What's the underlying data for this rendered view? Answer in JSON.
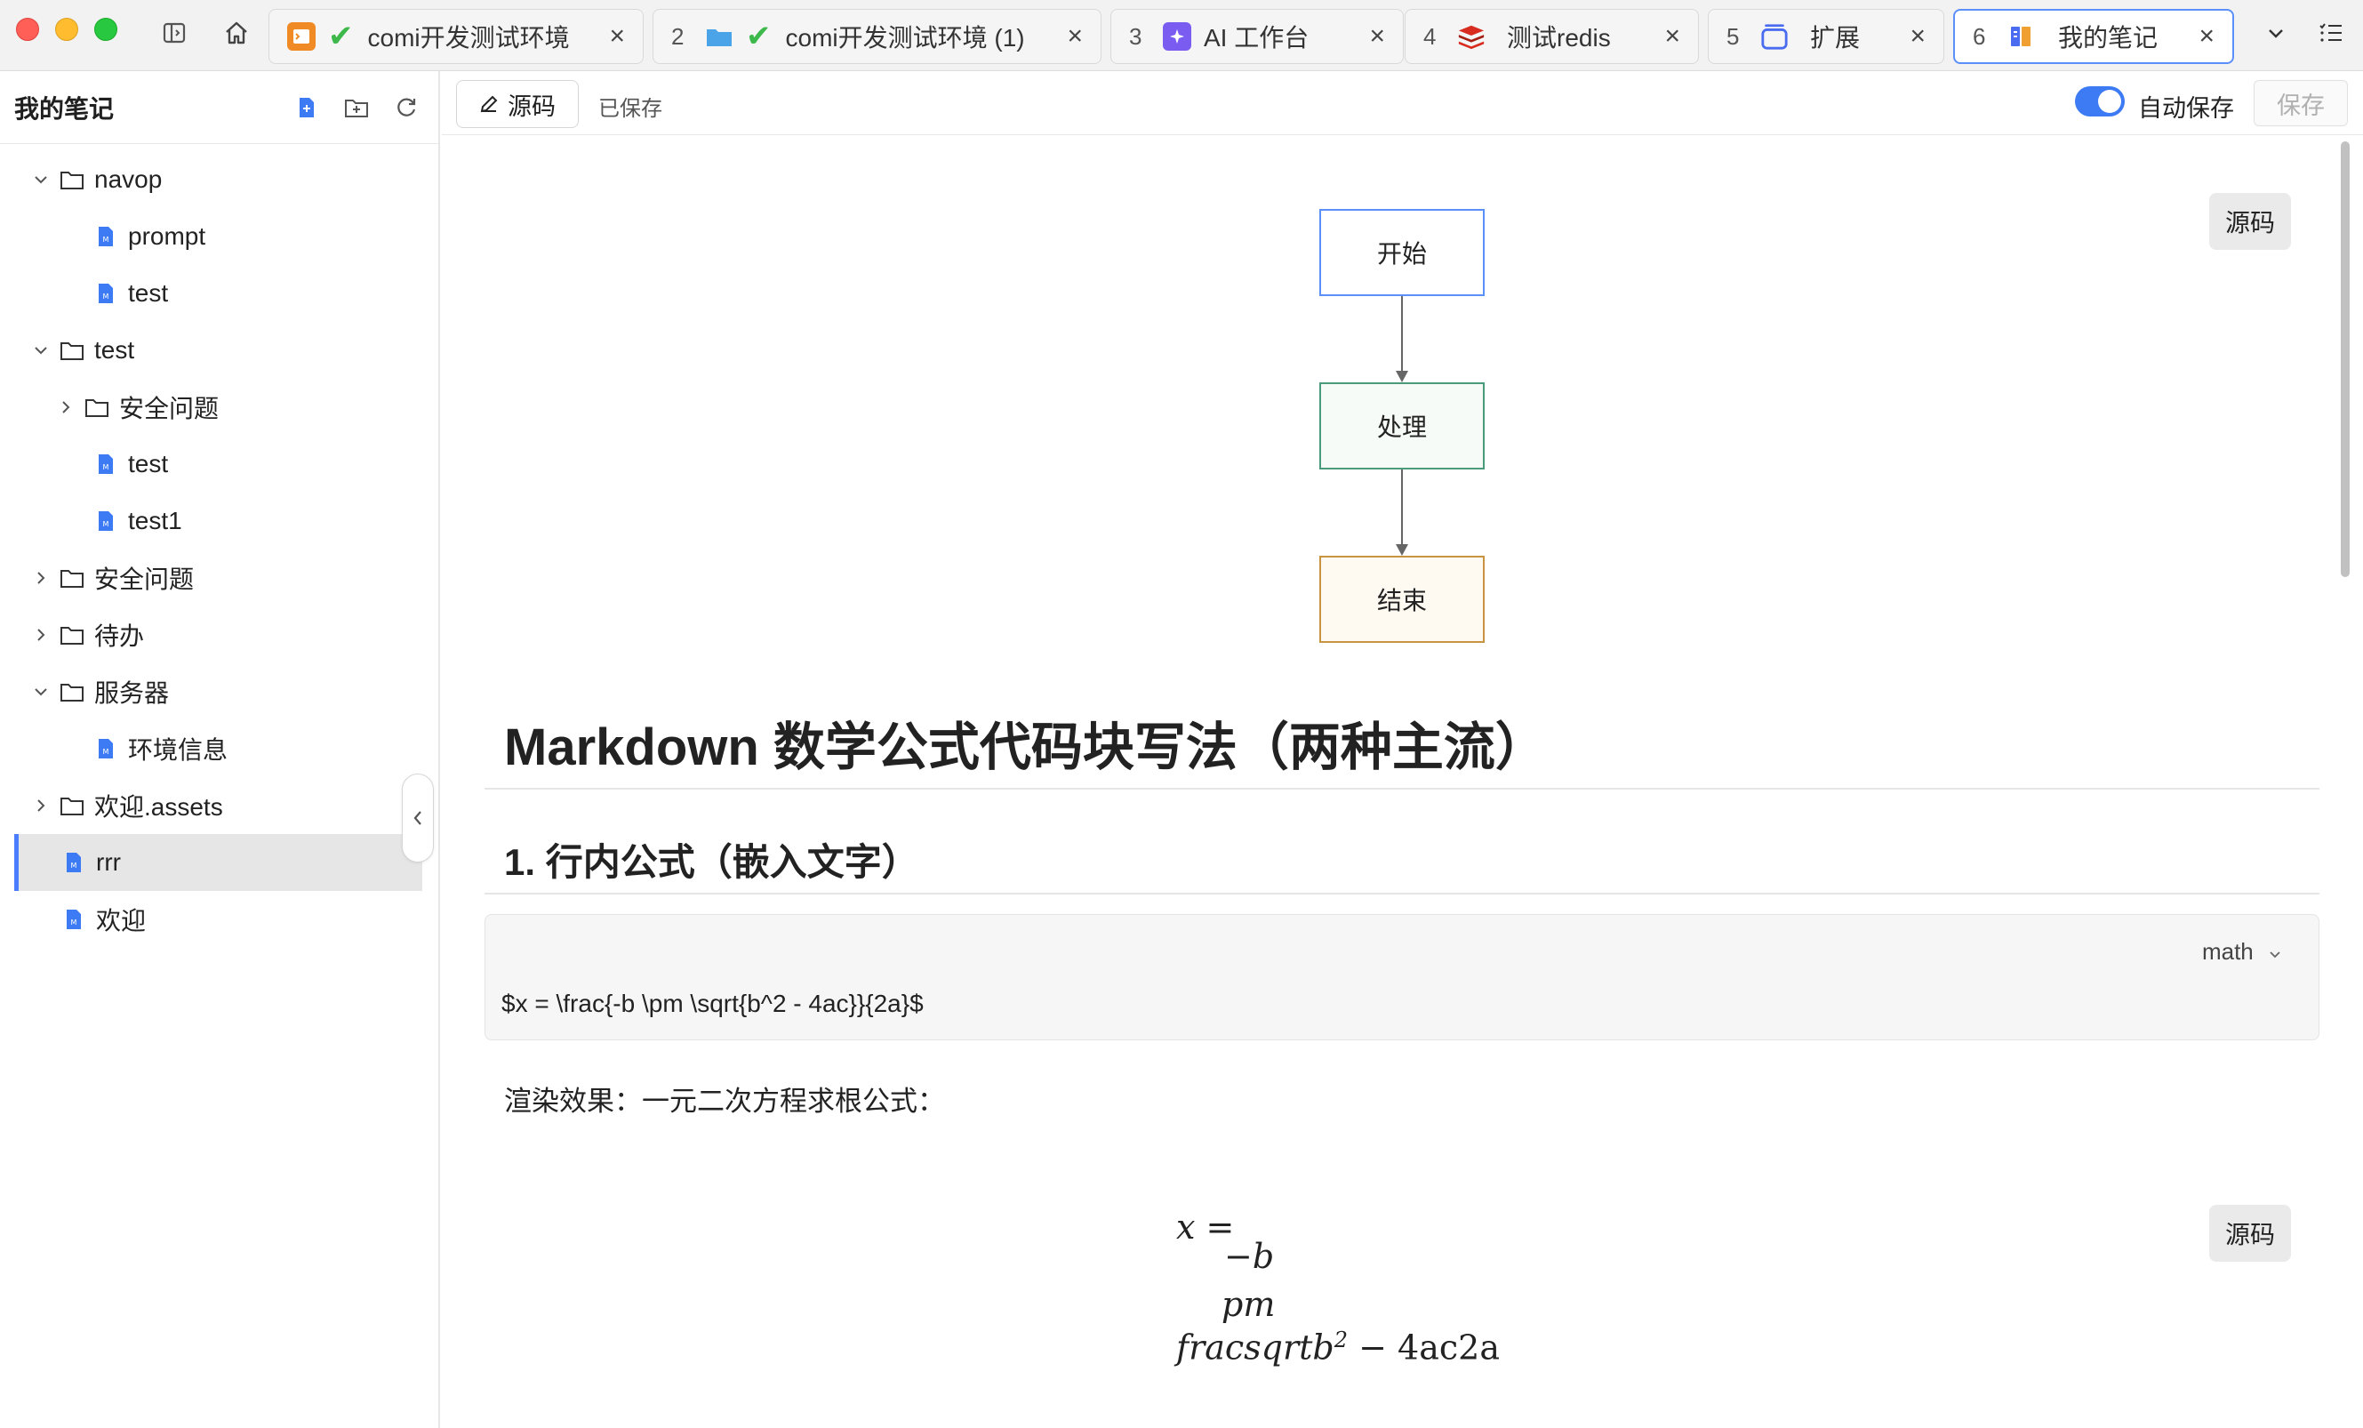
{
  "tabs": [
    {
      "num": "",
      "label": "comi开发测试环境",
      "active": false
    },
    {
      "num": "2",
      "label": "comi开发测试环境 (1)",
      "active": false
    },
    {
      "num": "3",
      "label": "AI 工作台",
      "active": false
    },
    {
      "num": "4",
      "label": "测试redis",
      "active": false
    },
    {
      "num": "5",
      "label": "扩展",
      "active": false
    },
    {
      "num": "6",
      "label": "我的笔记",
      "active": true
    }
  ],
  "tab_close": "×",
  "sidebar": {
    "title": "我的笔记",
    "tree": [
      {
        "label": "navop",
        "type": "folder",
        "expanded": true,
        "depth": 0
      },
      {
        "label": "prompt",
        "type": "file",
        "depth": 1
      },
      {
        "label": "test",
        "type": "file",
        "depth": 1
      },
      {
        "label": "test",
        "type": "folder",
        "expanded": true,
        "depth": 0
      },
      {
        "label": "安全问题",
        "type": "folder",
        "expanded": false,
        "depth": 1
      },
      {
        "label": "test",
        "type": "file",
        "depth": 1
      },
      {
        "label": "test1",
        "type": "file",
        "depth": 1
      },
      {
        "label": "安全问题",
        "type": "folder",
        "expanded": false,
        "depth": 0
      },
      {
        "label": "待办",
        "type": "folder",
        "expanded": false,
        "depth": 0
      },
      {
        "label": "服务器",
        "type": "folder",
        "expanded": true,
        "depth": 0
      },
      {
        "label": "环境信息",
        "type": "file",
        "depth": 1
      },
      {
        "label": "欢迎.assets",
        "type": "folder",
        "expanded": false,
        "depth": 0
      },
      {
        "label": "rrr",
        "type": "file",
        "depth": 0,
        "selected": true
      },
      {
        "label": "欢迎",
        "type": "file",
        "depth": 0
      }
    ]
  },
  "toolbar": {
    "source_button": "源码",
    "status": "已保存",
    "autosave_label": "自动保存",
    "autosave_on": true,
    "save_button": "保存"
  },
  "document": {
    "source_float_label": "源码",
    "flowchart": {
      "start": "开始",
      "process": "处理",
      "end": "结束"
    },
    "h1": "Markdown 数学公式代码块写法（两种主流）",
    "h2": "1. 行内公式（嵌入文字）",
    "code_lang": "math",
    "code": "$x = \\frac{-b \\pm \\sqrt{b^2 - 4ac}}{2a}$",
    "render_caption": "渲染效果：一元二次方程求根公式：",
    "math_line1": "x =",
    "math_line2": "−b",
    "math_line3": "pm",
    "math_line4_a": "fracsqrtb",
    "math_line4_sup": "2",
    "math_line4_b": " − 4ac2a"
  },
  "colors": {
    "accent": "#3d7bf4",
    "active_tab_border": "#5b8ff9",
    "flow_start": "#5b8ff9",
    "flow_process": "#4a9a7c",
    "flow_end": "#c8943f"
  }
}
